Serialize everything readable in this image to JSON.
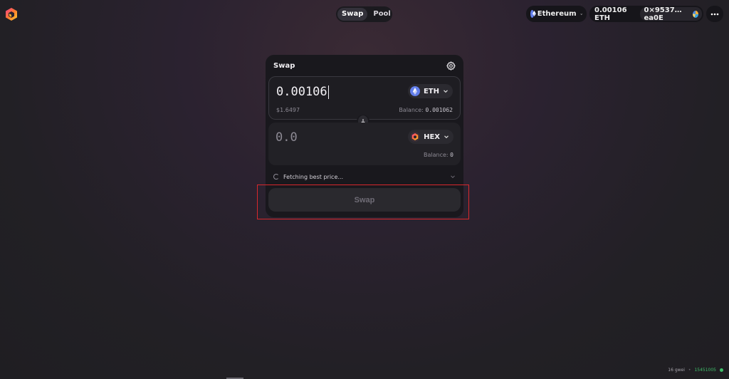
{
  "nav": {
    "tabs": [
      {
        "label": "Swap",
        "active": true
      },
      {
        "label": "Pool",
        "active": false
      }
    ]
  },
  "network": {
    "label": "Ethereum",
    "icon": "ethereum-icon"
  },
  "wallet": {
    "balance": "0.00106 ETH",
    "address": "0×9537…ea0E"
  },
  "card": {
    "title": "Swap",
    "from": {
      "amount": "0.00106",
      "token": "ETH",
      "usd_value": "$1.6497",
      "balance_label": "Balance:",
      "balance_value": "0.001062"
    },
    "to": {
      "amount_placeholder": "0.0",
      "token": "HEX",
      "balance_label": "Balance:",
      "balance_value": "0"
    },
    "status": "Fetching best price...",
    "swap_button": "Swap"
  },
  "footer": {
    "gas": "16 gwei",
    "separator": "•",
    "block": "15451005"
  },
  "colors": {
    "accent_highlight": "#d8282c",
    "eth": "#627eea",
    "live": "#3fbf6a"
  }
}
